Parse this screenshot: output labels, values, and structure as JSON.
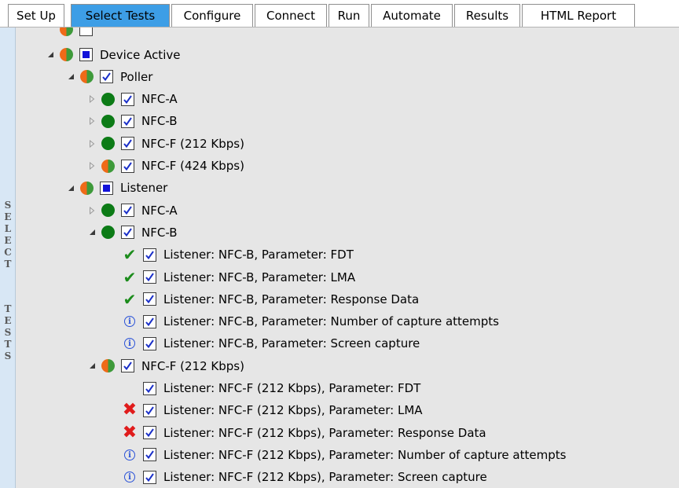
{
  "tabs": [
    {
      "label": "Set Up",
      "active": false
    },
    {
      "label": "Select Tests",
      "active": true
    },
    {
      "label": "Configure",
      "active": false
    },
    {
      "label": "Connect",
      "active": false
    },
    {
      "label": "Run",
      "active": false
    },
    {
      "label": "Automate",
      "active": false
    },
    {
      "label": "Results",
      "active": false
    },
    {
      "label": "HTML Report",
      "active": false
    }
  ],
  "side_label": {
    "word1": "SELECT",
    "word2": "TESTS"
  },
  "colors": {
    "active_tab": "#3d9ee6",
    "pass_green": "#0c7b16",
    "partial_orange": "#ef6a18",
    "fail_red": "#e01b1b",
    "info_blue": "#2a52d8",
    "checkbox_blue": "#1212d9",
    "tree_background": "#e6e6e6",
    "side_strip": "#d8e7f5"
  },
  "tree": {
    "rows": [
      {
        "label": "Device Active",
        "level": 1,
        "expander": "expanded",
        "status": "mixed",
        "check": "partial"
      },
      {
        "label": "Poller",
        "level": 2,
        "expander": "expanded",
        "status": "mixed",
        "check": "checked"
      },
      {
        "label": "NFC-A",
        "level": 3,
        "expander": "collapsed",
        "status": "pass",
        "check": "checked"
      },
      {
        "label": "NFC-B",
        "level": 3,
        "expander": "collapsed",
        "status": "pass",
        "check": "checked"
      },
      {
        "label": "NFC-F (212 Kbps)",
        "level": 3,
        "expander": "collapsed",
        "status": "pass",
        "check": "checked"
      },
      {
        "label": "NFC-F (424 Kbps)",
        "level": 3,
        "expander": "collapsed",
        "status": "mixed",
        "check": "checked"
      },
      {
        "label": "Listener",
        "level": 2,
        "expander": "expanded",
        "status": "mixed",
        "check": "partial"
      },
      {
        "label": "NFC-A",
        "level": 3,
        "expander": "collapsed",
        "status": "pass",
        "check": "checked"
      },
      {
        "label": "NFC-B",
        "level": 3,
        "expander": "expanded",
        "status": "pass",
        "check": "checked"
      },
      {
        "label": "Listener: NFC-B, Parameter: FDT",
        "level": 4,
        "expander": "none",
        "status": "check",
        "check": "checked"
      },
      {
        "label": "Listener: NFC-B, Parameter: LMA",
        "level": 4,
        "expander": "none",
        "status": "check",
        "check": "checked"
      },
      {
        "label": "Listener: NFC-B, Parameter: Response Data",
        "level": 4,
        "expander": "none",
        "status": "check",
        "check": "checked"
      },
      {
        "label": "Listener: NFC-B, Parameter: Number of capture attempts",
        "level": 4,
        "expander": "none",
        "status": "info",
        "check": "checked"
      },
      {
        "label": "Listener: NFC-B, Parameter: Screen capture",
        "level": 4,
        "expander": "none",
        "status": "info",
        "check": "checked"
      },
      {
        "label": "NFC-F (212 Kbps)",
        "level": 3,
        "expander": "expanded",
        "status": "mixed",
        "check": "checked"
      },
      {
        "label": "Listener: NFC-F (212 Kbps), Parameter: FDT",
        "level": 4,
        "expander": "none",
        "status": "none",
        "check": "checked"
      },
      {
        "label": "Listener: NFC-F (212 Kbps), Parameter: LMA",
        "level": 4,
        "expander": "none",
        "status": "fail",
        "check": "checked"
      },
      {
        "label": "Listener: NFC-F (212 Kbps), Parameter: Response Data",
        "level": 4,
        "expander": "none",
        "status": "fail",
        "check": "checked"
      },
      {
        "label": "Listener: NFC-F (212 Kbps), Parameter: Number of capture attempts",
        "level": 4,
        "expander": "none",
        "status": "info",
        "check": "checked"
      },
      {
        "label": "Listener: NFC-F (212 Kbps), Parameter: Screen capture",
        "level": 4,
        "expander": "none",
        "status": "info",
        "check": "checked"
      }
    ]
  }
}
